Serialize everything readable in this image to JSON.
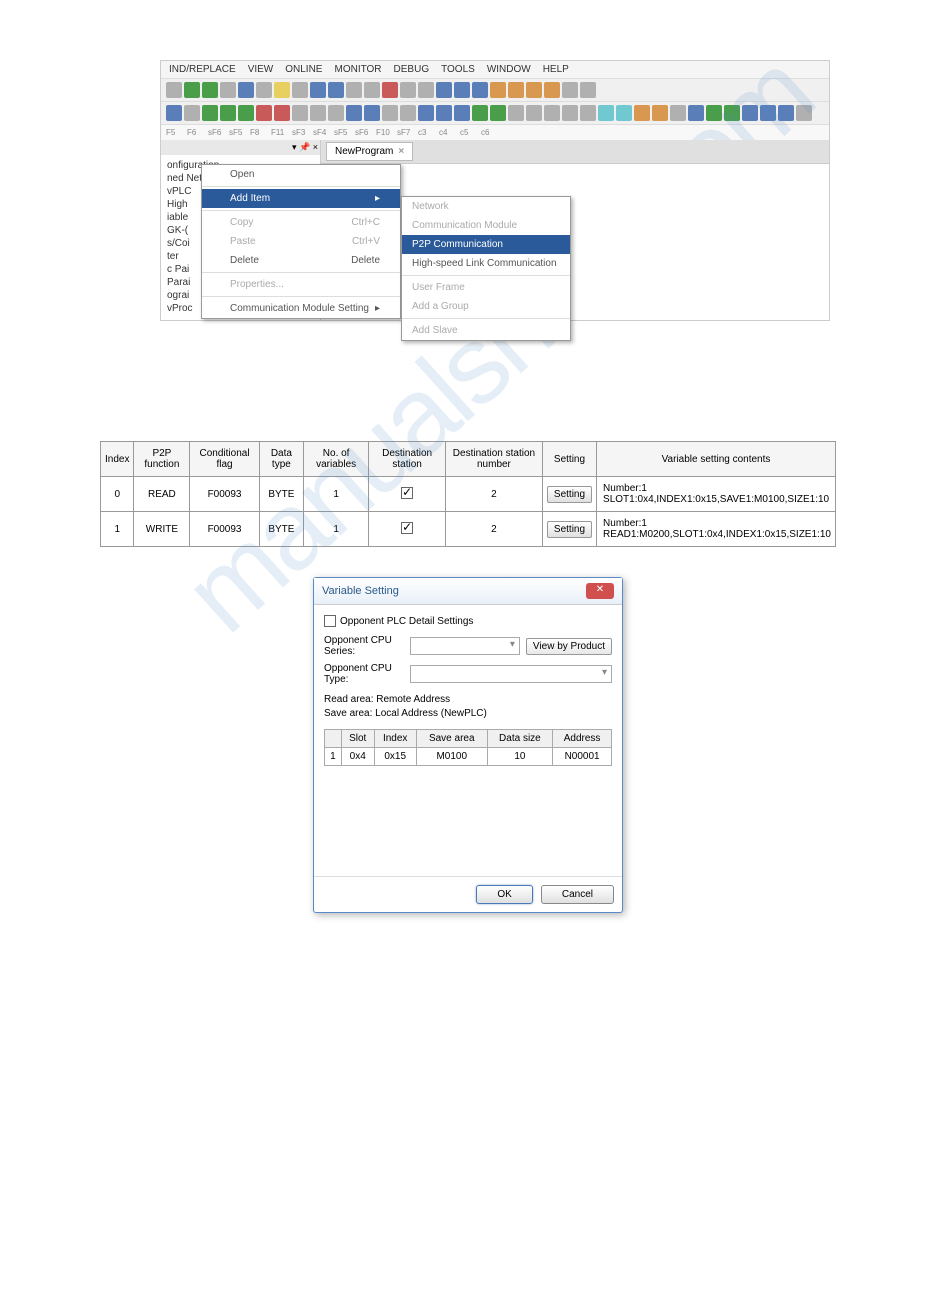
{
  "menubar": [
    "IND/REPLACE",
    "VIEW",
    "ONLINE",
    "MONITOR",
    "DEBUG",
    "TOOLS",
    "WINDOW",
    "HELP"
  ],
  "sidebar_tree": [
    "onfiguration",
    "ned Network",
    "vPLC",
    "High",
    "iable",
    "GK-(",
    "s/Coi",
    "ter",
    "c Pai",
    "Parai",
    "ograi",
    "vProc"
  ],
  "tab": {
    "name": "NewProgram",
    "close": "×"
  },
  "context_menu": {
    "open": "Open",
    "add_item": "Add Item",
    "copy": {
      "label": "Copy",
      "shortcut": "Ctrl+C"
    },
    "paste": {
      "label": "Paste",
      "shortcut": "Ctrl+V"
    },
    "delete": {
      "label": "Delete",
      "shortcut": "Delete"
    },
    "properties": "Properties...",
    "comm_setting": "Communication Module Setting"
  },
  "submenu": {
    "network": "Network",
    "comm_module": "Communication Module",
    "p2p_comm": "P2P Communication",
    "hs_link": "High-speed Link Communication",
    "user_frame": "User Frame",
    "add_group": "Add a Group",
    "add_slave": "Add Slave"
  },
  "p2p_headers": {
    "index": "Index",
    "function": "P2P function",
    "flag": "Conditional flag",
    "dtype": "Data type",
    "nvars": "No. of variables",
    "dest_station": "Destination station",
    "dest_num": "Destination station number",
    "setting": "Setting",
    "vsc": "Variable setting contents"
  },
  "p2p_rows": [
    {
      "index": "0",
      "function": "READ",
      "flag": "F00093",
      "dtype": "BYTE",
      "nvars": "1",
      "dest_checked": true,
      "dest_num": "2",
      "setting": "Setting",
      "vsc_line1": "Number:1",
      "vsc_line2": "SLOT1:0x4,INDEX1:0x15,SAVE1:M0100,SIZE1:10"
    },
    {
      "index": "1",
      "function": "WRITE",
      "flag": "F00093",
      "dtype": "BYTE",
      "nvars": "1",
      "dest_checked": true,
      "dest_num": "2",
      "setting": "Setting",
      "vsc_line1": "Number:1",
      "vsc_line2": "READ1:M0200,SLOT1:0x4,INDEX1:0x15,SIZE1:10"
    }
  ],
  "var_dialog": {
    "title": "Variable Setting",
    "detail_checkbox": "Opponent PLC Detail Settings",
    "cpu_series_label": "Opponent CPU Series:",
    "cpu_type_label": "Opponent CPU Type:",
    "view_by_product": "View by Product",
    "read_area": "Read area: Remote Address",
    "save_area": "Save area: Local Address (NewPLC)",
    "table_headers": {
      "row": "",
      "slot": "Slot",
      "index": "Index",
      "save": "Save area",
      "size": "Data size",
      "addr": "Address"
    },
    "table_row": {
      "num": "1",
      "slot": "0x4",
      "index": "0x15",
      "save": "M0100",
      "size": "10",
      "addr": "N00001"
    },
    "ok": "OK",
    "cancel": "Cancel"
  },
  "watermark": "manualshive.com"
}
